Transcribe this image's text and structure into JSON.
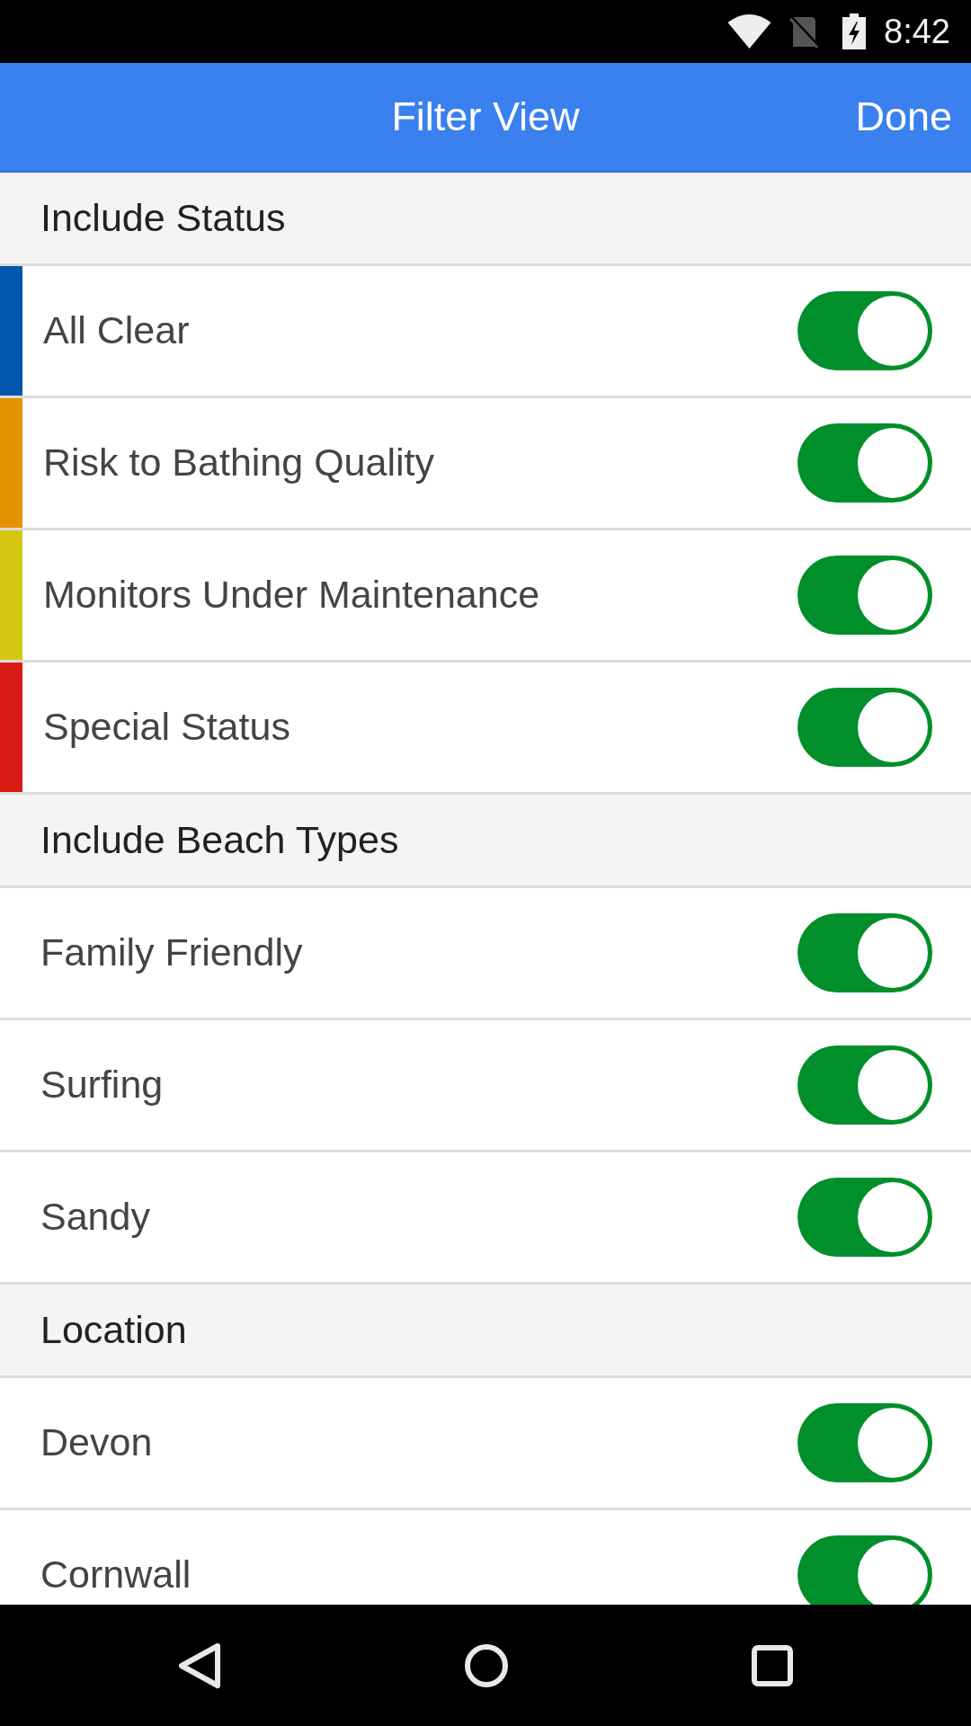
{
  "status_bar": {
    "time": "8:42"
  },
  "app_bar": {
    "title": "Filter View",
    "action": "Done"
  },
  "sections": [
    {
      "title": "Include Status",
      "items": [
        {
          "label": "All Clear",
          "color": "#0057ad",
          "on": true
        },
        {
          "label": "Risk to Bathing Quality",
          "color": "#e59400",
          "on": true
        },
        {
          "label": "Monitors Under Maintenance",
          "color": "#d4c813",
          "on": true
        },
        {
          "label": "Special Status",
          "color": "#d81b14",
          "on": true
        }
      ]
    },
    {
      "title": "Include Beach Types",
      "items": [
        {
          "label": "Family Friendly",
          "on": true
        },
        {
          "label": "Surfing",
          "on": true
        },
        {
          "label": "Sandy",
          "on": true
        }
      ]
    },
    {
      "title": "Location",
      "items": [
        {
          "label": "Devon",
          "on": true
        },
        {
          "label": "Cornwall",
          "on": true
        }
      ]
    }
  ]
}
